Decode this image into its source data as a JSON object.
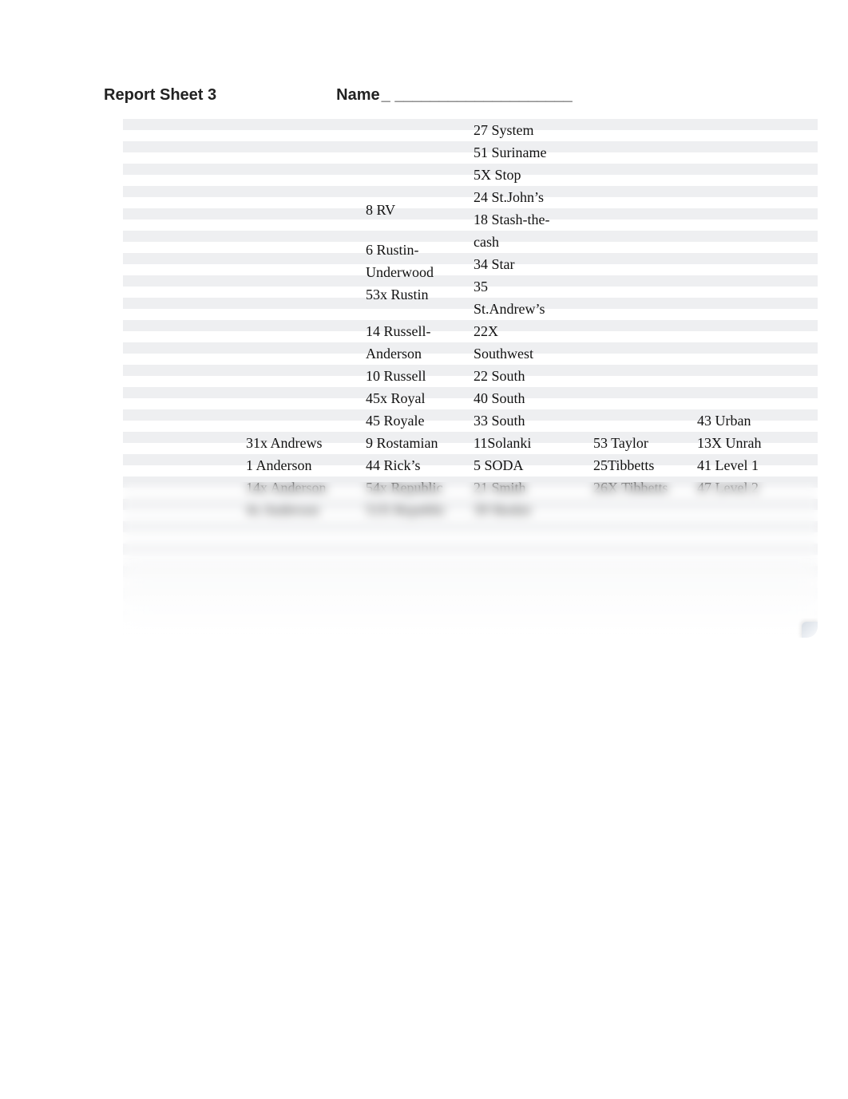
{
  "header": {
    "title": "Report Sheet 3",
    "name_label": "Name",
    "name_line": "_ ____________________"
  },
  "columns": [
    {
      "cells": []
    },
    {
      "cells": [
        "31x Andrews",
        "1 Anderson",
        "14x Anderson",
        "4x Anderson"
      ]
    },
    {
      "cells": [
        "8 RV",
        "6 Rustin-",
        "Underwood",
        "53x Rustin",
        "14 Russell-",
        "Anderson",
        "10 Russell",
        "45x Royal",
        "45 Royale",
        "9 Rostamian",
        "44 Rick’s",
        "54x Republic",
        "51X Republic"
      ]
    },
    {
      "cells": [
        "27 System",
        "51 Suriname",
        "5X Stop",
        "24 St.John’s",
        "18 Stash-the-",
        "cash",
        "34 Star",
        "35",
        "St.Andrew’s",
        "22X",
        "Southwest",
        "22 South",
        "40 South",
        "33 South",
        "11Solanki",
        "5 SODA",
        "21 Smith",
        "39 Skokie"
      ]
    },
    {
      "cells": [
        "53 Taylor",
        "25Tibbetts",
        "26X Tibbetts"
      ]
    },
    {
      "cells": [
        "43 Urban",
        "13X Unrah",
        "41 Level 1",
        "47 Level 2"
      ]
    }
  ]
}
